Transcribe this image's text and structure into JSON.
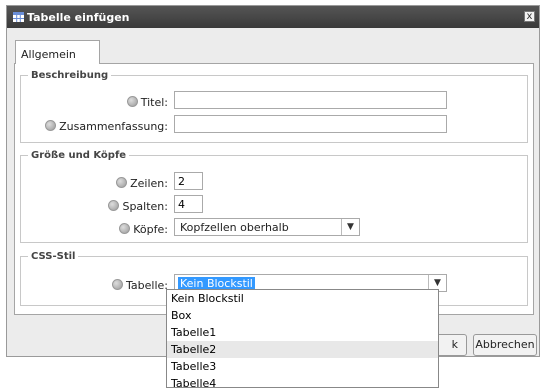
{
  "dialog": {
    "title": "Tabelle einfügen",
    "close_glyph": "x",
    "tab_label": "Allgemein"
  },
  "beschreibung": {
    "legend": "Beschreibung",
    "title_label": "Titel:",
    "title_value": "",
    "summary_label": "Zusammenfassung:",
    "summary_value": ""
  },
  "groesse": {
    "legend": "Größe und Köpfe",
    "rows_label": "Zeilen:",
    "rows_value": "2",
    "cols_label": "Spalten:",
    "cols_value": "4",
    "heads_label": "Köpfe:",
    "heads_value": "Kopfzellen oberhalb"
  },
  "css": {
    "legend": "CSS-Stil",
    "table_label": "Tabelle:",
    "table_value": "Kein Blockstil",
    "options": [
      "Kein Blockstil",
      "Box",
      "Tabelle1",
      "Tabelle2",
      "Tabelle3",
      "Tabelle4"
    ],
    "hovered_option": "Tabelle2"
  },
  "footer": {
    "ok_partial": "k",
    "cancel_label": "Abbrechen"
  },
  "icons": {
    "title": "table-icon",
    "help": "help-icon",
    "dropdown": "chevron-down-icon"
  },
  "colors": {
    "titlebar": "#444444",
    "selection": "#3399ff"
  }
}
